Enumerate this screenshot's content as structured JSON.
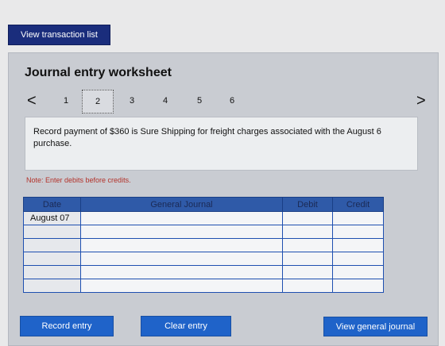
{
  "top": {
    "view_transactions_label": "View transaction list"
  },
  "worksheet": {
    "title": "Journal entry worksheet",
    "pager": {
      "prev": "<",
      "next": ">",
      "pages": [
        "1",
        "2",
        "3",
        "4",
        "5",
        "6"
      ],
      "active": "2"
    },
    "instruction": "Record payment of $360 is Sure Shipping for freight charges associated with the August 6 purchase.",
    "note": "Note: Enter debits before credits.",
    "table": {
      "headers": {
        "date": "Date",
        "journal": "General Journal",
        "debit": "Debit",
        "credit": "Credit"
      },
      "rows": [
        {
          "date": "August 07",
          "journal": "",
          "debit": "",
          "credit": ""
        },
        {
          "date": "",
          "journal": "",
          "debit": "",
          "credit": ""
        },
        {
          "date": "",
          "journal": "",
          "debit": "",
          "credit": ""
        },
        {
          "date": "",
          "journal": "",
          "debit": "",
          "credit": ""
        },
        {
          "date": "",
          "journal": "",
          "debit": "",
          "credit": ""
        },
        {
          "date": "",
          "journal": "",
          "debit": "",
          "credit": ""
        }
      ]
    },
    "buttons": {
      "record": "Record entry",
      "clear": "Clear entry",
      "view_journal": "View general journal"
    }
  }
}
